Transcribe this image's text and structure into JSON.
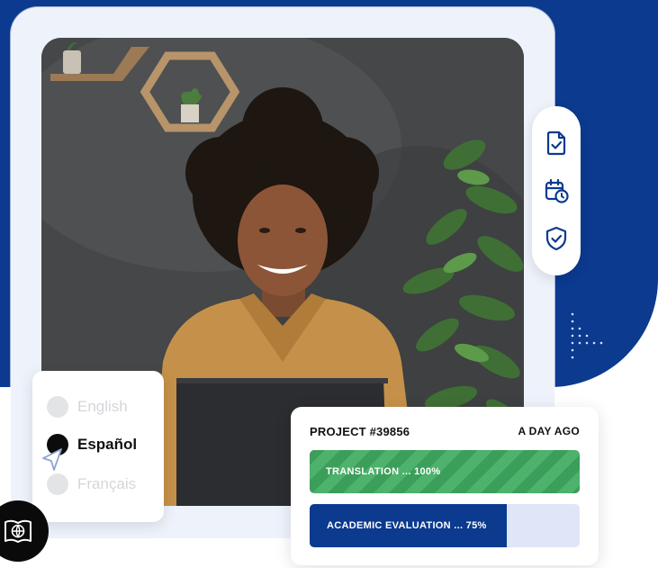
{
  "languages": {
    "items": [
      {
        "label": "English",
        "state": "inactive"
      },
      {
        "label": "Español",
        "state": "active"
      },
      {
        "label": "Français",
        "state": "inactive"
      }
    ]
  },
  "project": {
    "id": "PROJECT #39856",
    "time": "A DAY AGO",
    "bars": [
      {
        "label": "TRANSLATION ... 100%",
        "progress": 1.0,
        "color": "#3c9e5b"
      },
      {
        "label": "ACADEMIC EVALUATION ... 75%",
        "progress": 0.73,
        "color": "#0b3a8f"
      }
    ]
  },
  "icons": {
    "rail": [
      "document-check-icon",
      "calendar-clock-icon",
      "shield-check-icon"
    ],
    "badge": "book-globe-icon",
    "cursor": "cursor-arrow-icon"
  },
  "colors": {
    "brand_blue": "#0b3a8f",
    "success_green": "#3c9e5b",
    "frame_bg": "#eef2fb"
  }
}
